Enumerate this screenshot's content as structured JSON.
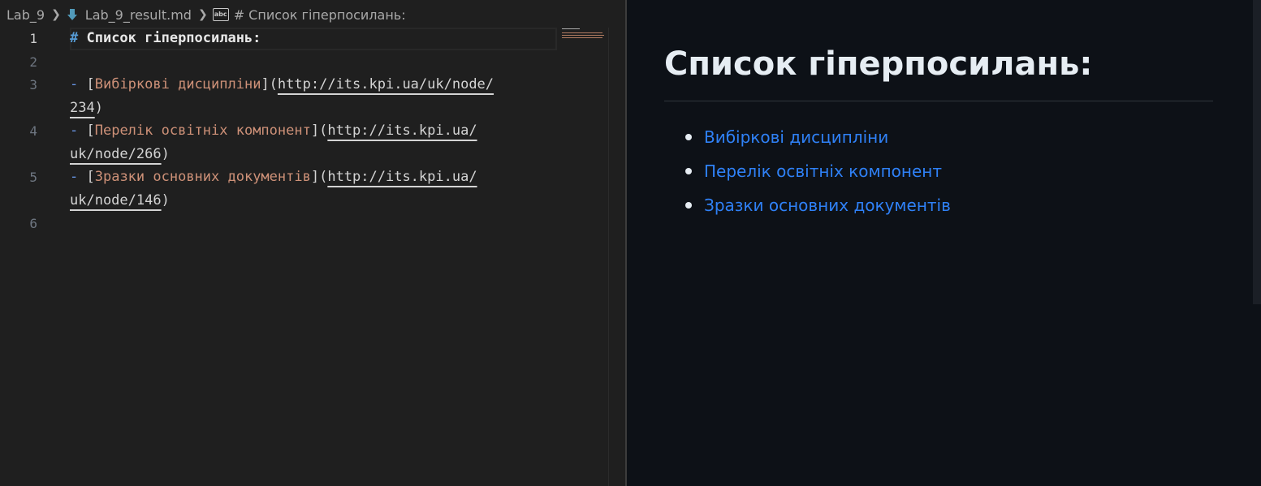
{
  "breadcrumb": {
    "folder": "Lab_9",
    "file": "Lab_9_result.md",
    "symbol": "# Список гіперпосилань:",
    "icons": [
      "markdown-file-icon",
      "symbol-string-icon",
      "chevron-right-icon"
    ]
  },
  "editor": {
    "line_numbers": [
      "1",
      "2",
      "3",
      "4",
      "5",
      "6"
    ],
    "active_line": "1",
    "lines": {
      "l1": {
        "hash": "#",
        "heading": " Список гіперпосилань:"
      },
      "l3": {
        "bullet": "- ",
        "open": "[",
        "text": "Вибіркові дисципліни",
        "mid": "](",
        "url_a": "http://its.kpi.ua/uk/node/",
        "url_b": "234",
        "close": ")"
      },
      "l4": {
        "bullet": "- ",
        "open": "[",
        "text": "Перелік освітніх компонент",
        "mid": "](",
        "url_a": "http://its.kpi.ua/",
        "url_b": "uk/node/266",
        "close": ")"
      },
      "l5": {
        "bullet": "- ",
        "open": "[",
        "text": "Зразки основних документів",
        "mid": "](",
        "url_a": "http://its.kpi.ua/",
        "url_b": "uk/node/146",
        "close": ")"
      }
    }
  },
  "preview": {
    "title": "Список гіперпосилань:",
    "links": [
      "Вибіркові дисципліни",
      "Перелік освітніх компонент",
      "Зразки основних документів"
    ]
  },
  "colors": {
    "editor_bg": "#1f1f1f",
    "preview_bg": "#0d1117",
    "link": "#2f81f7",
    "md_link_text": "#ce9178",
    "md_punct": "#569cd6"
  }
}
